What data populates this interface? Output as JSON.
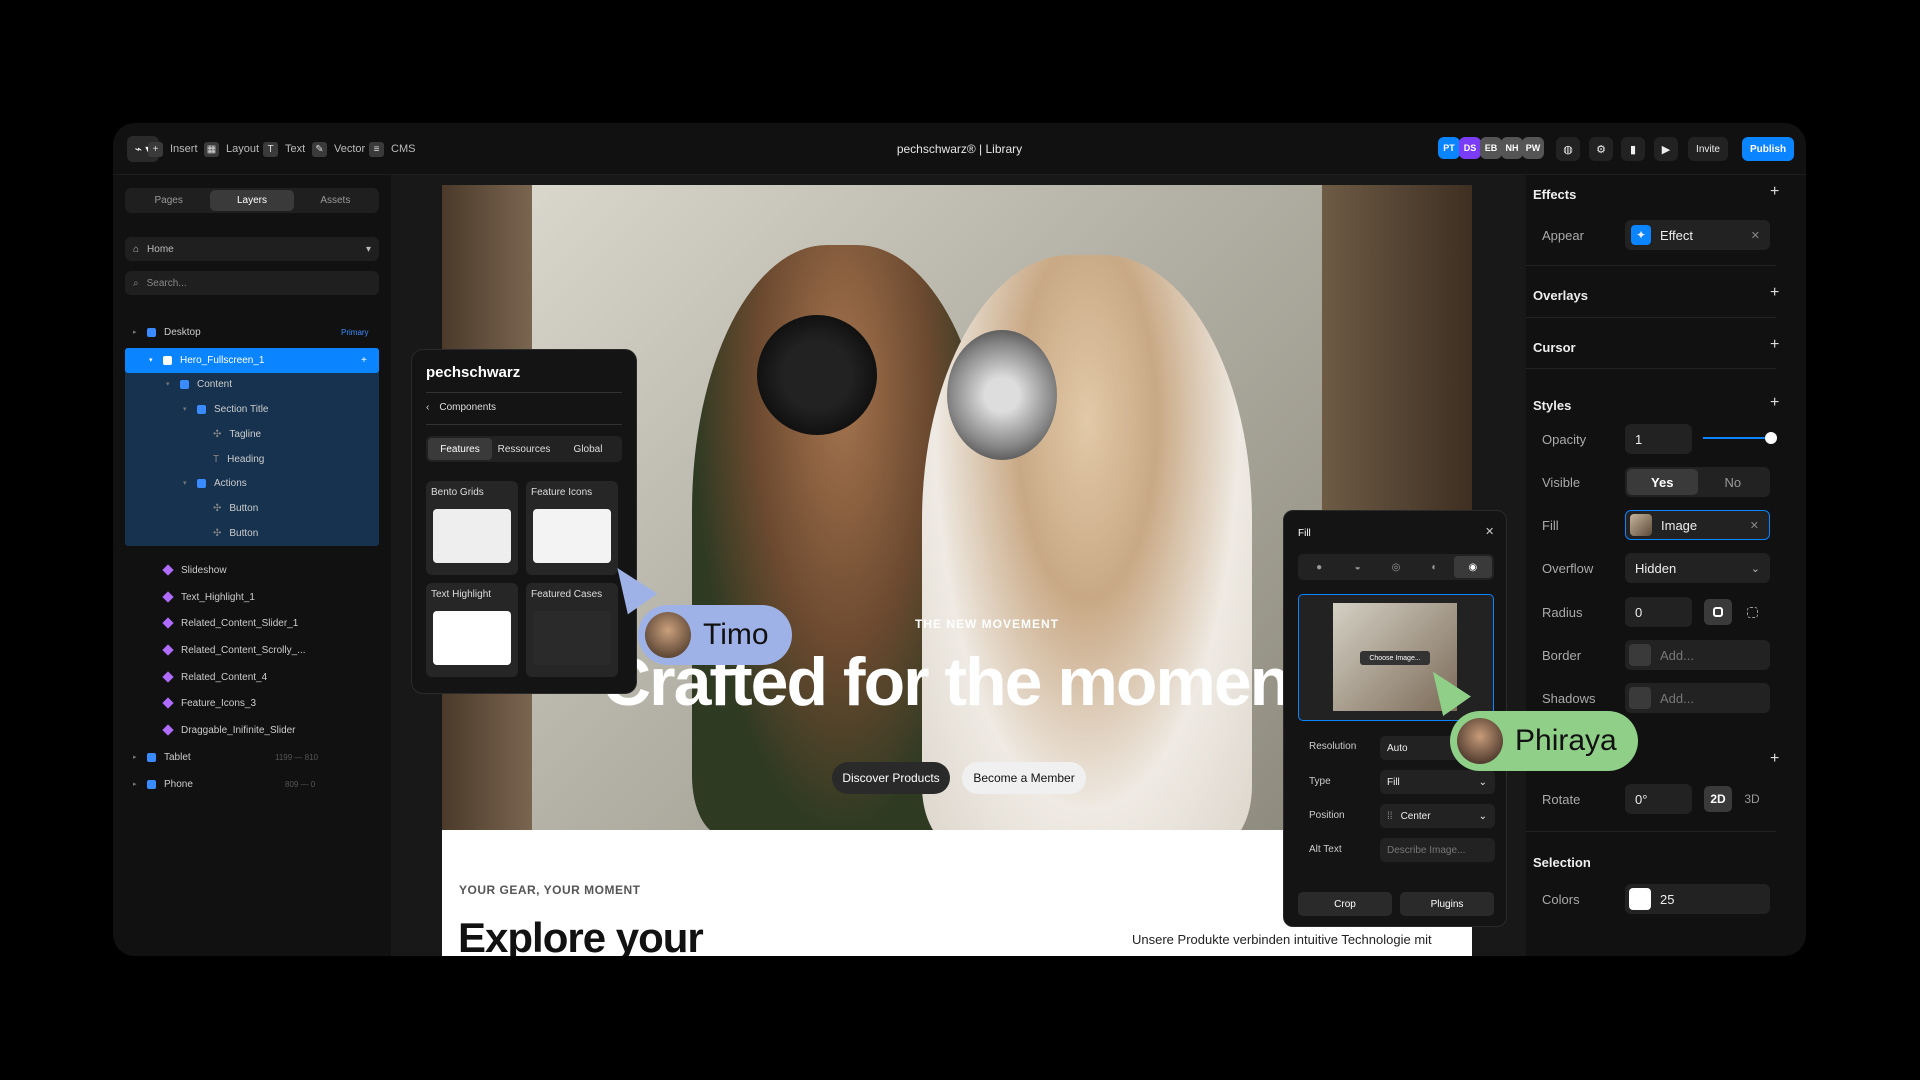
{
  "toolbar": {
    "insert": "Insert",
    "layout": "Layout",
    "text": "Text",
    "vector": "Vector",
    "cms": "CMS",
    "title": "pechschwarz® | Library",
    "avatars": [
      {
        "initials": "PT",
        "color": "#0a84ff"
      },
      {
        "initials": "DS",
        "color": "#7b3cf5"
      },
      {
        "initials": "EB",
        "color": "#555"
      },
      {
        "initials": "NH",
        "color": "#555"
      },
      {
        "initials": "PW",
        "color": "#555"
      }
    ],
    "invite": "Invite",
    "publish": "Publish"
  },
  "left": {
    "tabs": [
      "Pages",
      "Layers",
      "Assets"
    ],
    "page_select": "Home",
    "search_placeholder": "Search...",
    "layers": {
      "desktop": "Desktop",
      "desktop_badge": "Primary",
      "hero": "Hero_Fullscreen_1",
      "content": "Content",
      "section_title": "Section Title",
      "tagline": "Tagline",
      "heading": "Heading",
      "actions": "Actions",
      "button1": "Button",
      "button2": "Button",
      "slideshow": "Slideshow",
      "text_highlight": "Text_Highlight_1",
      "rc_slider": "Related_Content_Slider_1",
      "rc_scrolly": "Related_Content_Scrolly_...",
      "rc4": "Related_Content_4",
      "feature_icons": "Feature_Icons_3",
      "draggable": "Draggable_Inifinite_Slider",
      "tablet": "Tablet",
      "tablet_range": "1199 — 810",
      "phone": "Phone",
      "phone_range": "809 — 0"
    }
  },
  "components": {
    "brand": "pechschwarz",
    "back": "Components",
    "tabs": [
      "Features",
      "Ressources",
      "Global"
    ],
    "cards": [
      "Bento Grids",
      "Feature Icons",
      "Text Highlight",
      "Featured Cases"
    ]
  },
  "hero": {
    "tagline": "THE NEW MOVEMENT",
    "heading": "Crafted for the momen",
    "btn1": "Discover Products",
    "btn2": "Become a Member"
  },
  "below": {
    "eyebrow": "YOUR GEAR, YOUR MOMENT",
    "heading": "Explore your",
    "body": "Unsere Produkte verbinden intuitive Technologie mit"
  },
  "cursors": {
    "timo": "Timo",
    "phiraya": "Phiraya"
  },
  "fill_panel": {
    "title": "Fill",
    "choose": "Choose Image...",
    "resolution_label": "Resolution",
    "resolution": "Auto",
    "type_label": "Type",
    "type": "Fill",
    "position_label": "Position",
    "position": "Center",
    "alt_label": "Alt Text",
    "alt_placeholder": "Describe Image...",
    "crop": "Crop",
    "plugins": "Plugins"
  },
  "right": {
    "effects": "Effects",
    "appear": "Appear",
    "effect": "Effect",
    "overlays": "Overlays",
    "cursor": "Cursor",
    "styles": "Styles",
    "opacity": "Opacity",
    "opacity_value": "1",
    "opacity_level": 1,
    "visible": "Visible",
    "yes": "Yes",
    "no": "No",
    "fill": "Fill",
    "fill_value": "Image",
    "overflow": "Overflow",
    "overflow_value": "Hidden",
    "radius": "Radius",
    "radius_value": "0",
    "border": "Border",
    "border_placeholder": "Add...",
    "shadows": "Shadows",
    "shadows_placeholder": "Add...",
    "rotate": "Rotate",
    "rotate_value": "0°",
    "d2": "2D",
    "d3": "3D",
    "selection": "Selection",
    "colors": "Colors",
    "colors_value": "25"
  }
}
